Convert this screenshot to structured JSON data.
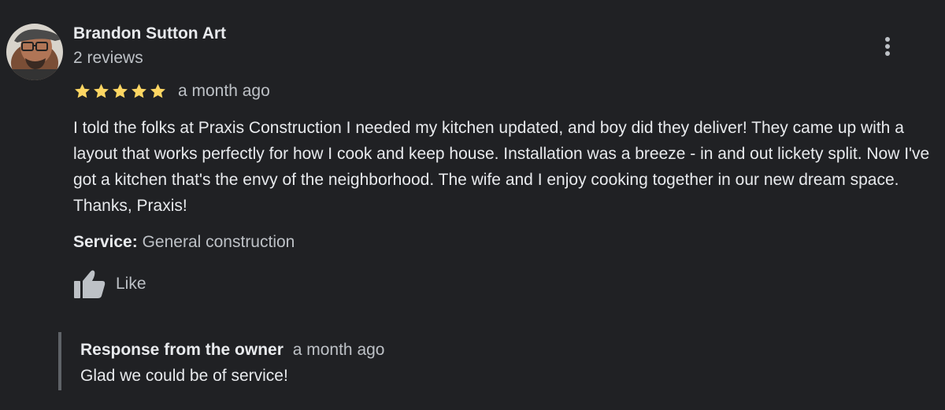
{
  "review": {
    "author_name": "Brandon Sutton Art",
    "review_count": "2 reviews",
    "rating": 5,
    "rating_max": 5,
    "date": "a month ago",
    "text": "I told the folks at Praxis Construction I needed my kitchen updated, and boy did they deliver! They came up with a layout that works perfectly for how I cook and keep house. Installation was a breeze - in and out lickety split. Now I've got a kitchen that's the envy of the neighborhood. The wife and I enjoy cooking together in our new dream space. Thanks, Praxis!",
    "service_label": "Service:",
    "service_value": "General construction",
    "like_label": "Like"
  },
  "owner_response": {
    "title": "Response from the owner",
    "date": "a month ago",
    "text": "Glad we could be of service!"
  },
  "icons": {
    "more": "more-vert-icon",
    "like": "thumbs-up-icon",
    "star": "star-icon"
  },
  "colors": {
    "background": "#202124",
    "primary_text": "#e8eaed",
    "secondary_text": "#bdc1c6",
    "star": "#fdd663",
    "response_border": "#5f6368"
  }
}
